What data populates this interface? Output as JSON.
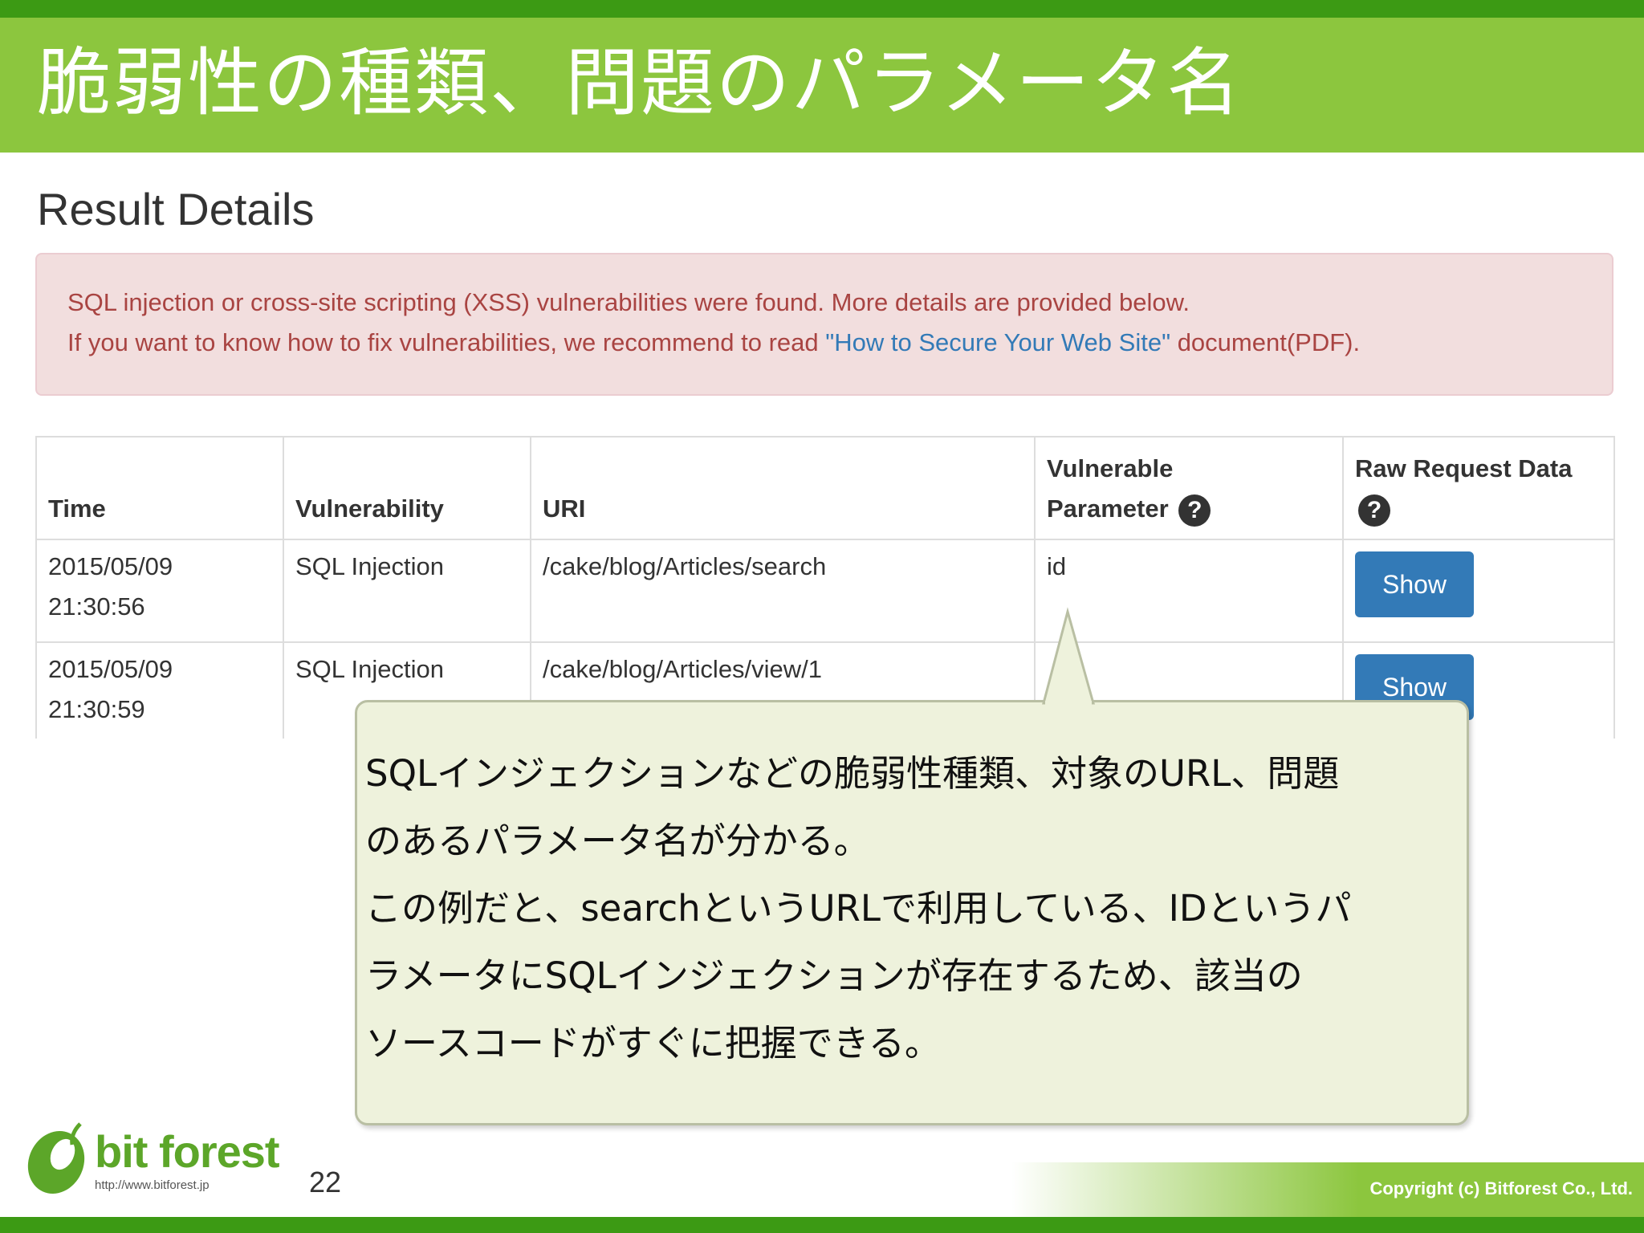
{
  "slide": {
    "title": "脆弱性の種類、問題のパラメータ名",
    "page_number": "22",
    "copyright": "Copyright (c)  Bitforest Co., Ltd.",
    "logo_name": "bit forest",
    "logo_url": "http://www.bitforest.jp"
  },
  "result": {
    "heading": "Result Details",
    "alert_line1": "SQL injection or cross-site scripting (XSS) vulnerabilities were found. More details are provided below.",
    "alert_line2_prefix": "If you want to know how to fix vulnerabilities, we recommend to read ",
    "alert_link": "\"How to Secure Your Web Site\"",
    "alert_line2_suffix": " document(PDF).",
    "columns": {
      "time": "Time",
      "vulnerability": "Vulnerability",
      "uri": "URI",
      "param_line1": "Vulnerable",
      "param_line2": "Parameter",
      "raw": "Raw Request Data"
    },
    "help_icon": "?",
    "rows": [
      {
        "date": "2015/05/09",
        "time": "21:30:56",
        "vulnerability": "SQL Injection",
        "uri": "/cake/blog/Articles/search",
        "parameter": "id",
        "button": "Show"
      },
      {
        "date": "2015/05/09",
        "time": "21:30:59",
        "vulnerability": "SQL Injection",
        "uri": "/cake/blog/Articles/view/1",
        "parameter": "",
        "button": "Show"
      }
    ]
  },
  "callout": {
    "lines": [
      "SQLインジェクションなどの脆弱性種類、対象のURL、問題",
      "のあるパラメータ名が分かる。",
      "この例だと、searchというURLで利用している、IDというパ",
      "ラメータにSQLインジェクションが存在するため、該当の",
      "ソースコードがすぐに把握できる。"
    ]
  },
  "colors": {
    "title_bar": "#8cc63e",
    "stripe": "#3c9a14",
    "alert_bg": "#f2dede",
    "alert_text": "#a94442",
    "link": "#337ab7",
    "button": "#337ab7",
    "callout_bg": "#eef2dc"
  },
  "icons": {
    "help": "question-circle-icon",
    "logo": "leaf-logo-icon"
  }
}
